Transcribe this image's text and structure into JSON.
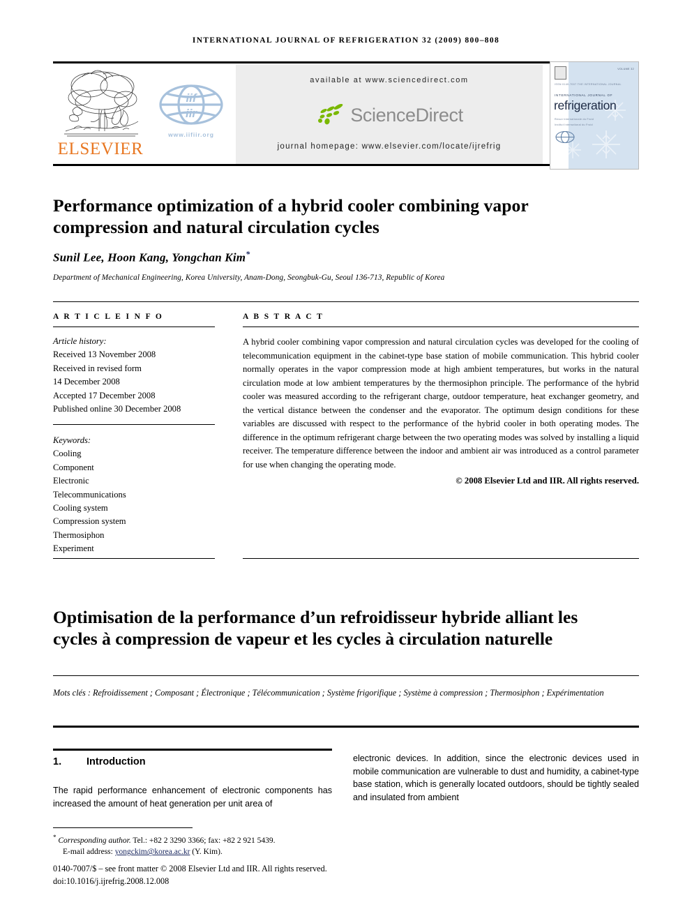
{
  "running_head": "INTERNATIONAL JOURNAL OF REFRIGERATION 32 (2009) 800–808",
  "masthead": {
    "elsevier_wordmark": "ELSEVIER",
    "iifiir_url": "www.iifiir.org",
    "sciencedirect": {
      "available_at": "available at www.sciencedirect.com",
      "wordmark": "ScienceDirect",
      "journal_homepage": "journal homepage: www.elsevier.com/locate/ijrefrig"
    },
    "cover": {
      "volume_note": "VOLUME 32",
      "tiny_line": "ISSN 0140-7007 THE INTERNATIONAL JOURNAL",
      "international_journal_of": "INTERNATIONAL JOURNAL OF",
      "title": "refrigeration",
      "sub_line_1": "Revue Internationale du Froid",
      "sub_line_2": "Institut International du Froid"
    }
  },
  "article": {
    "title": "Performance optimization of a hybrid cooler combining vapor compression and natural circulation cycles",
    "authors": "Sunil Lee, Hoon Kang, Yongchan Kim",
    "corresponding_marker": "*",
    "affiliation": "Department of Mechanical Engineering, Korea University, Anam-Dong, Seongbuk-Gu, Seoul 136-713, Republic of Korea"
  },
  "article_info": {
    "label": "A R T I C L E   I N F O",
    "history_label": "Article history:",
    "history": [
      "Received 13 November 2008",
      "Received in revised form",
      "14 December 2008",
      "Accepted 17 December 2008",
      "Published online 30 December 2008"
    ],
    "keywords_label": "Keywords:",
    "keywords": [
      "Cooling",
      "Component",
      "Electronic",
      "Telecommunications",
      "Cooling system",
      "Compression system",
      "Thermosiphon",
      "Experiment"
    ]
  },
  "abstract": {
    "label": "A B S T R A C T",
    "text": "A hybrid cooler combining vapor compression and natural circulation cycles was developed for the cooling of telecommunication equipment in the cabinet-type base station of mobile communication. This hybrid cooler normally operates in the vapor compression mode at high ambient temperatures, but works in the natural circulation mode at low ambient temperatures by the thermosiphon principle. The performance of the hybrid cooler was measured according to the refrigerant charge, outdoor temperature, heat exchanger geometry, and the vertical distance between the condenser and the evaporator. The optimum design conditions for these variables are discussed with respect to the performance of the hybrid cooler in both operating modes. The difference in the optimum refrigerant charge between the two operating modes was solved by installing a liquid receiver. The temperature difference between the indoor and ambient air was introduced as a control parameter for use when changing the operating mode.",
    "copyright": "© 2008 Elsevier Ltd and IIR. All rights reserved."
  },
  "french": {
    "title": "Optimisation de la performance d’un refroidisseur hybride alliant les cycles à compression de vapeur et les cycles à circulation naturelle",
    "keywords": "Mots clés : Refroidissement ; Composant ; Électronique ; Télécommunication ; Système frigorifique ; Système à compression ; Thermosiphon ; Expérimentation"
  },
  "body": {
    "section_number": "1.",
    "section_title": "Introduction",
    "left_column": "The rapid performance enhancement of electronic components has increased the amount of heat generation per unit area of",
    "right_column": "electronic devices. In addition, since the electronic devices used in mobile communication are vulnerable to dust and humidity, a cabinet-type base station, which is generally located outdoors, should be tightly sealed and insulated from ambient"
  },
  "footer": {
    "corresponding_marker": "*",
    "corresponding_label": "Corresponding author.",
    "corresponding_contact": " Tel.: +82 2 3290 3366; fax: +82 2 921 5439.",
    "email_label": "E-mail address:",
    "email": "yongckim@korea.ac.kr",
    "email_owner": "(Y. Kim).",
    "issn_line": "0140-7007/$ – see front matter © 2008 Elsevier Ltd and IIR. All rights reserved.",
    "doi_line": "doi:10.1016/j.ijrefrig.2008.12.008"
  },
  "colors": {
    "elsevier_orange": "#E87722",
    "iifiir_blue": "#A7C1DC",
    "sciencedirect_green": "#7AB800",
    "sciencedirect_gray": "#8C8C8C",
    "link_blue": "#17255E",
    "cover_blue": "#D4E2F0"
  }
}
